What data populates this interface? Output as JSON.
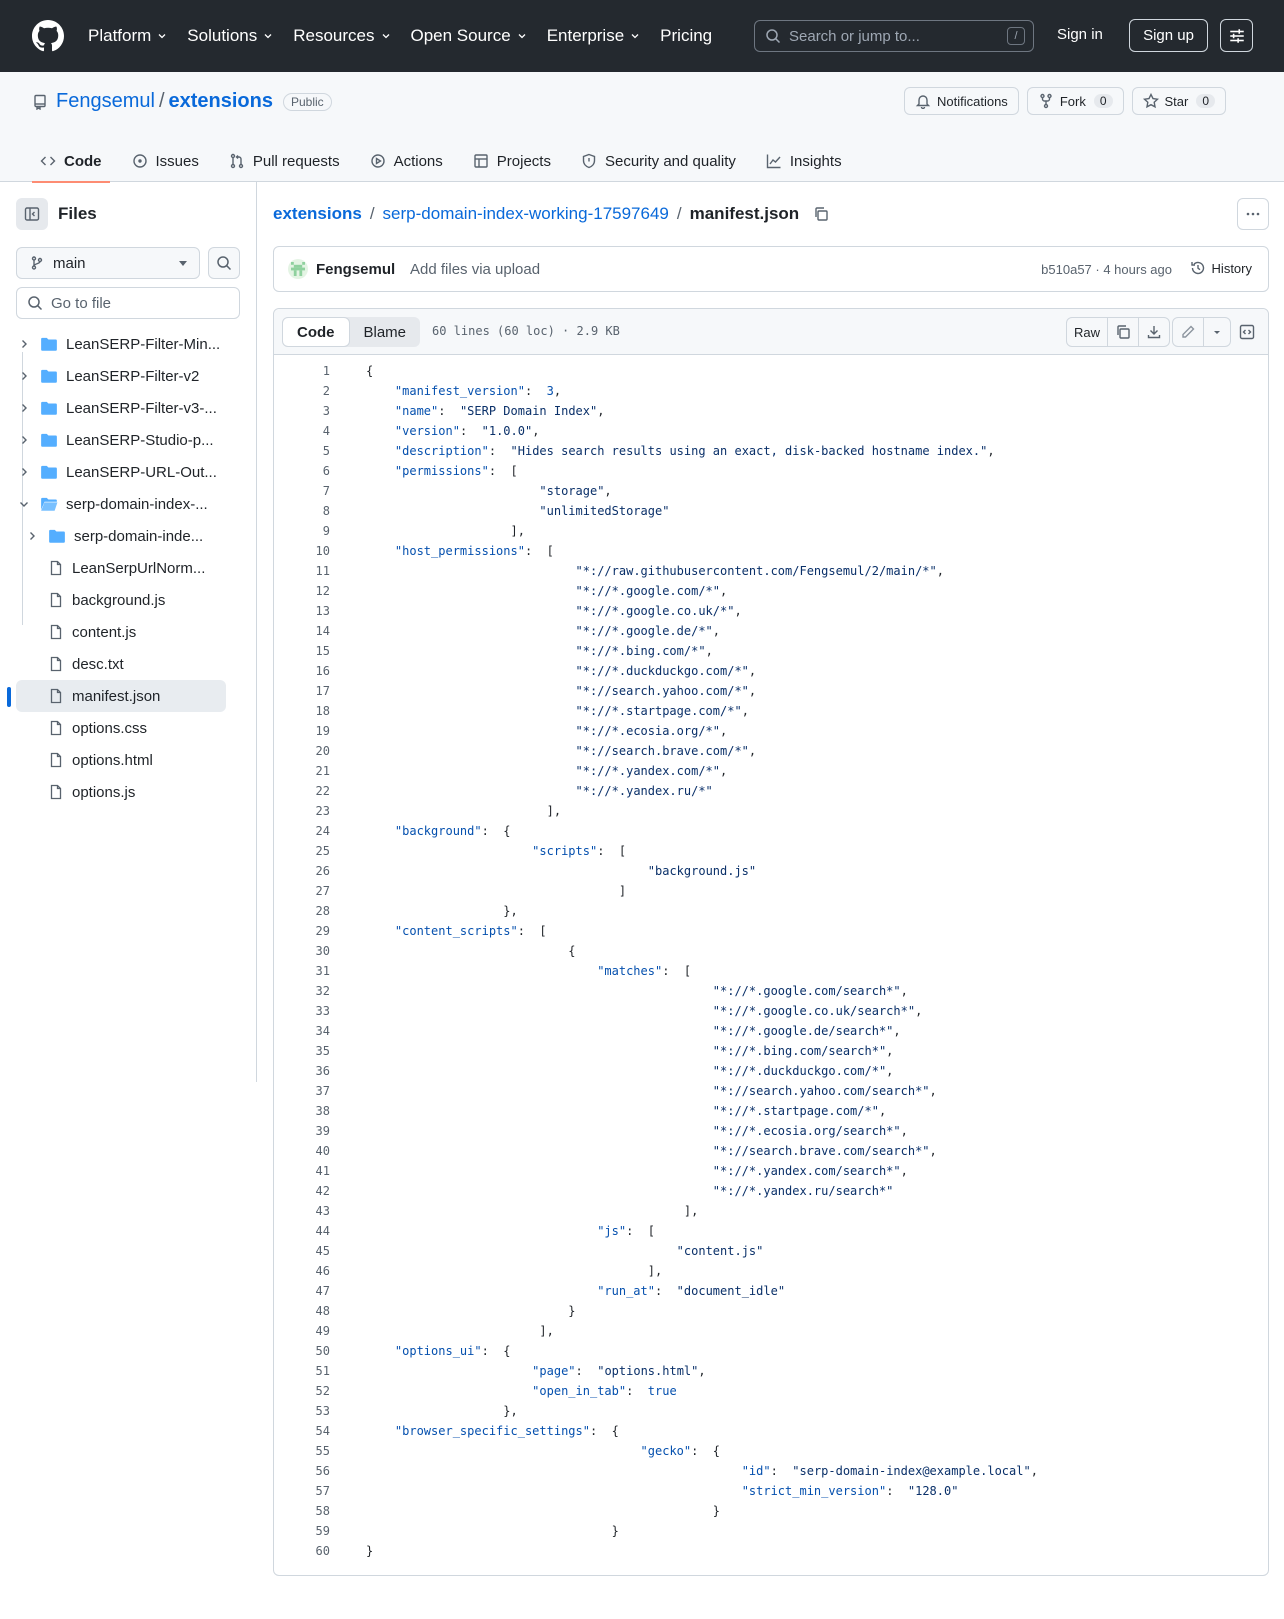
{
  "header": {
    "nav": [
      {
        "label": "Platform",
        "dropdown": true
      },
      {
        "label": "Solutions",
        "dropdown": true
      },
      {
        "label": "Resources",
        "dropdown": true
      },
      {
        "label": "Open Source",
        "dropdown": true
      },
      {
        "label": "Enterprise",
        "dropdown": true
      },
      {
        "label": "Pricing",
        "dropdown": false
      }
    ],
    "search_placeholder": "Search or jump to...",
    "search_shortcut": "/",
    "sign_in": "Sign in",
    "sign_up": "Sign up"
  },
  "repo": {
    "owner": "Fengsemul",
    "separator": "/",
    "name": "extensions",
    "visibility": "Public",
    "notifications_label": "Notifications",
    "fork_label": "Fork",
    "fork_count": "0",
    "star_label": "Star",
    "star_count": "0",
    "tabs": [
      {
        "label": "Code",
        "icon": "code-icon",
        "active": true
      },
      {
        "label": "Issues",
        "icon": "issue-icon",
        "active": false
      },
      {
        "label": "Pull requests",
        "icon": "pull-request-icon",
        "active": false
      },
      {
        "label": "Actions",
        "icon": "play-icon",
        "active": false
      },
      {
        "label": "Projects",
        "icon": "table-icon",
        "active": false
      },
      {
        "label": "Security and quality",
        "icon": "shield-icon",
        "active": false
      },
      {
        "label": "Insights",
        "icon": "graph-icon",
        "active": false
      }
    ]
  },
  "sidebar": {
    "title": "Files",
    "branch": "main",
    "goto_placeholder": "Go to file",
    "tree": [
      {
        "label": "LeanSERP-Filter-Min...",
        "type": "folder",
        "depth": 0,
        "expanded": false
      },
      {
        "label": "LeanSERP-Filter-v2",
        "type": "folder",
        "depth": 0,
        "expanded": false
      },
      {
        "label": "LeanSERP-Filter-v3-...",
        "type": "folder",
        "depth": 0,
        "expanded": false
      },
      {
        "label": "LeanSERP-Studio-p...",
        "type": "folder",
        "depth": 0,
        "expanded": false
      },
      {
        "label": "LeanSERP-URL-Out...",
        "type": "folder",
        "depth": 0,
        "expanded": false
      },
      {
        "label": "serp-domain-index-...",
        "type": "folder-open",
        "depth": 0,
        "expanded": true
      },
      {
        "label": "serp-domain-inde...",
        "type": "folder",
        "depth": 1,
        "expanded": false
      },
      {
        "label": "LeanSerpUrlNorm...",
        "type": "file",
        "depth": 1
      },
      {
        "label": "background.js",
        "type": "file",
        "depth": 1
      },
      {
        "label": "content.js",
        "type": "file",
        "depth": 1
      },
      {
        "label": "desc.txt",
        "type": "file",
        "depth": 1
      },
      {
        "label": "manifest.json",
        "type": "file",
        "depth": 1,
        "selected": true
      },
      {
        "label": "options.css",
        "type": "file",
        "depth": 1
      },
      {
        "label": "options.html",
        "type": "file",
        "depth": 1
      },
      {
        "label": "options.js",
        "type": "file",
        "depth": 1
      }
    ]
  },
  "breadcrumb": {
    "repo": "extensions",
    "folder": "serp-domain-index-working-17597649",
    "file": "manifest.json",
    "sep": "/"
  },
  "commit": {
    "author": "Fengsemul",
    "message": "Add files via upload",
    "hash_time": "b510a57 · 4 hours ago",
    "history_label": "History"
  },
  "file_view": {
    "tab_code": "Code",
    "tab_blame": "Blame",
    "info": "60 lines (60 loc) · 2.9 KB",
    "raw_label": "Raw"
  },
  "code": [
    "{",
    "    \"manifest_version\":  3,",
    "    \"name\":  \"SERP Domain Index\",",
    "    \"version\":  \"1.0.0\",",
    "    \"description\":  \"Hides search results using an exact, disk-backed hostname index.\",",
    "    \"permissions\":  [",
    "                        \"storage\",",
    "                        \"unlimitedStorage\"",
    "                    ],",
    "    \"host_permissions\":  [",
    "                             \"*://raw.githubusercontent.com/Fengsemul/2/main/*\",",
    "                             \"*://*.google.com/*\",",
    "                             \"*://*.google.co.uk/*\",",
    "                             \"*://*.google.de/*\",",
    "                             \"*://*.bing.com/*\",",
    "                             \"*://*.duckduckgo.com/*\",",
    "                             \"*://search.yahoo.com/*\",",
    "                             \"*://*.startpage.com/*\",",
    "                             \"*://*.ecosia.org/*\",",
    "                             \"*://search.brave.com/*\",",
    "                             \"*://*.yandex.com/*\",",
    "                             \"*://*.yandex.ru/*\"",
    "                         ],",
    "    \"background\":  {",
    "                       \"scripts\":  [",
    "                                       \"background.js\"",
    "                                   ]",
    "                   },",
    "    \"content_scripts\":  [",
    "                            {",
    "                                \"matches\":  [",
    "                                                \"*://*.google.com/search*\",",
    "                                                \"*://*.google.co.uk/search*\",",
    "                                                \"*://*.google.de/search*\",",
    "                                                \"*://*.bing.com/search*\",",
    "                                                \"*://*.duckduckgo.com/*\",",
    "                                                \"*://search.yahoo.com/search*\",",
    "                                                \"*://*.startpage.com/*\",",
    "                                                \"*://*.ecosia.org/search*\",",
    "                                                \"*://search.brave.com/search*\",",
    "                                                \"*://*.yandex.com/search*\",",
    "                                                \"*://*.yandex.ru/search*\"",
    "                                            ],",
    "                                \"js\":  [",
    "                                           \"content.js\"",
    "                                       ],",
    "                                \"run_at\":  \"document_idle\"",
    "                            }",
    "                        ],",
    "    \"options_ui\":  {",
    "                       \"page\":  \"options.html\",",
    "                       \"open_in_tab\":  true",
    "                   },",
    "    \"browser_specific_settings\":  {",
    "                                      \"gecko\":  {",
    "                                                    \"id\":  \"serp-domain-index@example.local\",",
    "                                                    \"strict_min_version\":  \"128.0\"",
    "                                                }",
    "                                  }",
    "}"
  ]
}
